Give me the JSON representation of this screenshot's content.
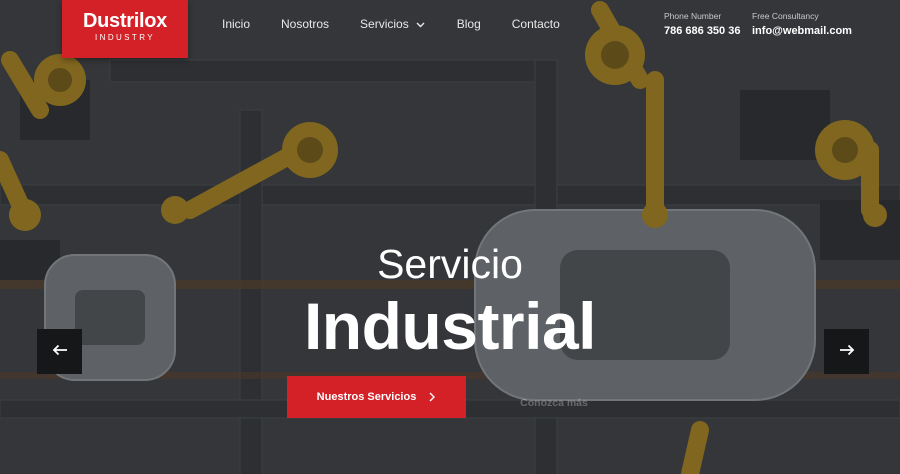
{
  "brand": {
    "name": "Dustrilox",
    "tagline": "INDUSTRY",
    "accent": "#d42027"
  },
  "nav": {
    "items": [
      {
        "label": "Inicio"
      },
      {
        "label": "Nosotros"
      },
      {
        "label": "Servicios",
        "icon": "chevron-down-icon"
      },
      {
        "label": "Blog"
      },
      {
        "label": "Contacto"
      }
    ]
  },
  "contact": {
    "phone": {
      "label": "Phone Number",
      "value": "786 686 350 36"
    },
    "consult": {
      "label": "Free Consultancy",
      "value": "info@webmail.com"
    }
  },
  "hero": {
    "line1": "Servicio",
    "line2": "Industrial",
    "primary_cta": "Nuestros Servicios",
    "primary_cta_icon": "chevron-right-icon",
    "secondary_cta": "Conozca más"
  },
  "slider": {
    "prev_icon": "arrow-left-icon",
    "next_icon": "arrow-right-icon"
  }
}
